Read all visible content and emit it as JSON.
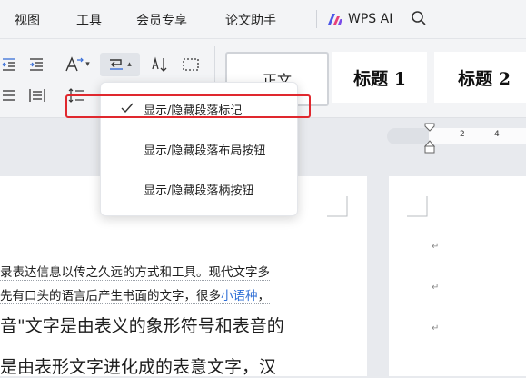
{
  "menubar": {
    "items": [
      "视图",
      "工具",
      "会员专享",
      "论文助手"
    ],
    "wps_ai": "WPS AI"
  },
  "styles": {
    "normal": "正文",
    "h1": "标题 1",
    "h2": "标题 2"
  },
  "ruler": {
    "ticks": [
      "2",
      "4"
    ]
  },
  "dropdown": {
    "items": [
      {
        "label": "显示/隐藏段落标记",
        "checked": true
      },
      {
        "label": "显示/隐藏段落布局按钮",
        "checked": false
      },
      {
        "label": "显示/隐藏段落柄按钮",
        "checked": false
      }
    ]
  },
  "document": {
    "line1": "录表达信息以传之久远的方式和工具。现代文字多",
    "line2_a": "先有口头的语言后产生书面的文字，很多",
    "line2_link": "小语种",
    "line2_b": "，",
    "line3": "音\"文字是由表义的象形符号和表音的",
    "line4": "是由表形文字进化成的表意文字，汉",
    "para_mark": "↵"
  },
  "colors": {
    "highlight_border": "#e0282e",
    "link": "#2f6fd6",
    "wps_ai_accent": "#4b57e8"
  }
}
